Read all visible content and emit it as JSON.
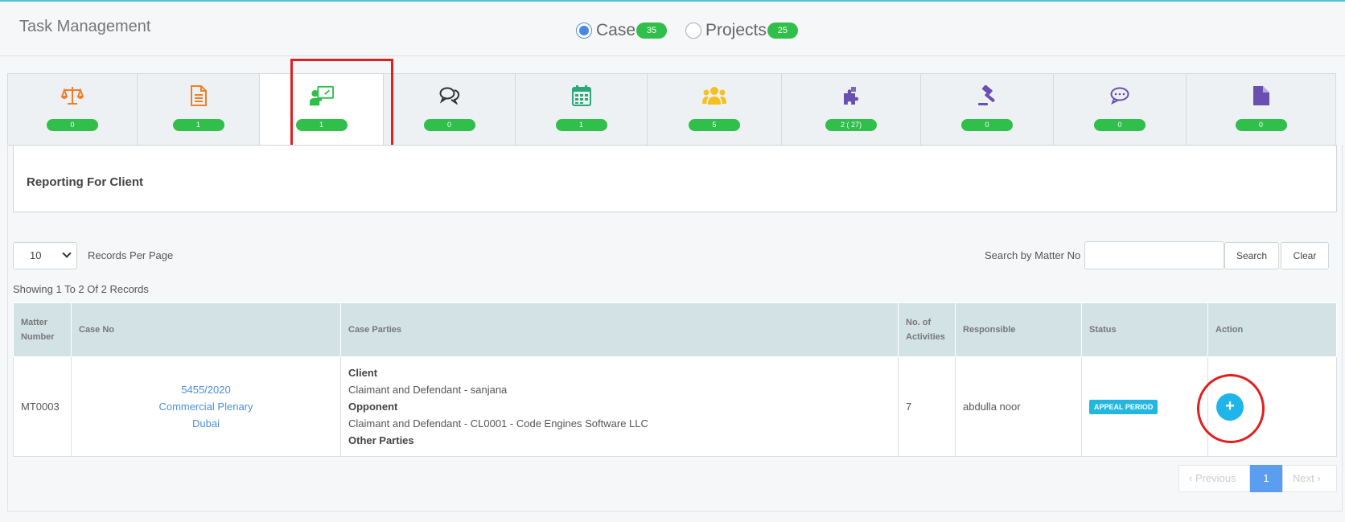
{
  "header": {
    "title": "Task Management",
    "toggles": [
      {
        "label": "Case",
        "count": "35",
        "selected": true
      },
      {
        "label": "Projects",
        "count": "25",
        "selected": false
      }
    ]
  },
  "tabs": [
    {
      "icon": "scales-icon",
      "count": "0",
      "color": "#f07e2a"
    },
    {
      "icon": "document-lines-icon",
      "count": "1",
      "color": "#f07e2a"
    },
    {
      "icon": "presentation-user-icon",
      "count": "1",
      "color": "#2fbf4a",
      "active": true
    },
    {
      "icon": "chat-bubbles-icon",
      "count": "0",
      "color": "#333333"
    },
    {
      "icon": "calendar-icon",
      "count": "1",
      "color": "#2aa876"
    },
    {
      "icon": "users-group-icon",
      "count": "5",
      "color": "#f5c120"
    },
    {
      "icon": "puzzle-icon",
      "count": "2 ( 27)",
      "color": "#6a4fb3"
    },
    {
      "icon": "gavel-icon",
      "count": "0",
      "color": "#6a4fb3"
    },
    {
      "icon": "comment-dots-icon",
      "count": "0",
      "color": "#6a4fb3"
    },
    {
      "icon": "file-icon",
      "count": "0",
      "color": "#6a4fb3"
    }
  ],
  "report": {
    "title": "Reporting For Client"
  },
  "controls": {
    "per_page_value": "10",
    "per_page_label": "Records Per Page",
    "search_label": "Search by Matter No",
    "search_value": "",
    "search_button": "Search",
    "clear_button": "Clear",
    "showing": "Showing 1 To 2 Of 2 Records"
  },
  "table": {
    "headers": {
      "matter_line1": "Matter",
      "matter_line2": "Number",
      "case_no": "Case No",
      "parties": "Case Parties",
      "acts_line1": "No. of",
      "acts_line2": "Activities",
      "responsible": "Responsible",
      "status": "Status",
      "action": "Action"
    },
    "rows": [
      {
        "matter": "MT0003",
        "case_no": "5455/2020",
        "case_type": "Commercial Plenary",
        "case_location": "Dubai",
        "client_label": "Client",
        "client": "Claimant and Defendant - sanjana",
        "opponent_label": "Opponent",
        "opponent": "Claimant and Defendant - CL0001 - Code Engines Software LLC",
        "other_label": "Other Parties",
        "activities": "7",
        "responsible": "abdulla noor",
        "status": "APPEAL PERIOD",
        "action_symbol": "+"
      }
    ]
  },
  "pager": {
    "prev": "‹ Previous",
    "current": "1",
    "next": "Next ›"
  }
}
